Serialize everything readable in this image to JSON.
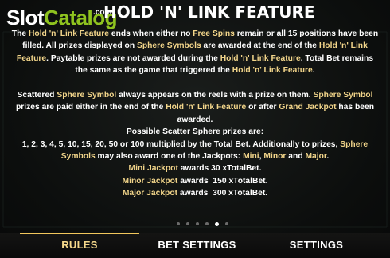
{
  "logo": {
    "slot": "Slot",
    "catalog": "Catalog",
    "com": ".com"
  },
  "title": "HOLD 'N' LINK FEATURE",
  "paragraph1": [
    [
      "t",
      "The "
    ],
    [
      "h",
      "Hold 'n' Link Feature"
    ],
    [
      "t",
      " ends when either no "
    ],
    [
      "h",
      "Free Spins"
    ],
    [
      "t",
      " remain or all 15 positions have been filled. All prizes displayed on "
    ],
    [
      "h",
      "Sphere Symbols"
    ],
    [
      "t",
      " are awarded at the end of the "
    ],
    [
      "h",
      "Hold 'n' Link Feature"
    ],
    [
      "t",
      ". Paytable prizes are not awarded during the "
    ],
    [
      "h",
      "Hold 'n' Link Feature"
    ],
    [
      "t",
      ". Total Bet remains the same as the game that triggered the "
    ],
    [
      "h",
      "Hold 'n' Link Feature"
    ],
    [
      "t",
      "."
    ]
  ],
  "paragraph2": [
    [
      "t",
      "Scattered "
    ],
    [
      "h",
      "Sphere Symbol"
    ],
    [
      "t",
      " always appears on the reels with a prize on them. "
    ],
    [
      "h",
      "Sphere Symbol"
    ],
    [
      "t",
      " prizes are paid either in the end of the "
    ],
    [
      "h",
      "Hold 'n' Link Feature"
    ],
    [
      "t",
      " or after "
    ],
    [
      "h",
      "Grand Jackpot"
    ],
    [
      "t",
      " has been awarded."
    ]
  ],
  "possible_heading": "Possible Scatter Sphere prizes are:",
  "paragraph3": [
    [
      "t",
      "1, 2, 3, 4, 5, 10, 15, 20, 50 or 100 multiplied by the Total Bet. Additionally to prizes, "
    ],
    [
      "h",
      "Sphere Symbols"
    ],
    [
      "t",
      " may also award one of the Jackpots: "
    ],
    [
      "h",
      "Mini"
    ],
    [
      "t",
      ", "
    ],
    [
      "h",
      "Minor"
    ],
    [
      "t",
      " and "
    ],
    [
      "h",
      "Major"
    ],
    [
      "t",
      "."
    ]
  ],
  "jackpots": [
    {
      "name": "Mini Jackpot",
      "text": " awards 30 xTotalBet."
    },
    {
      "name": "Minor Jackpot",
      "text": " awards  150 xTotalBet."
    },
    {
      "name": "Major Jackpot",
      "text": " awards  300 xTotalBet."
    }
  ],
  "pagination": {
    "total": 6,
    "active_index": 4
  },
  "tabs": [
    {
      "id": "rules",
      "label": "RULES",
      "active": true
    },
    {
      "id": "bet",
      "label": "BET SETTINGS",
      "active": false
    },
    {
      "id": "settings",
      "label": "SETTINGS",
      "active": false
    }
  ],
  "colors": {
    "highlight": "#f2d58a",
    "accent": "#f2c75c",
    "logo_green": "#8fc31f"
  }
}
